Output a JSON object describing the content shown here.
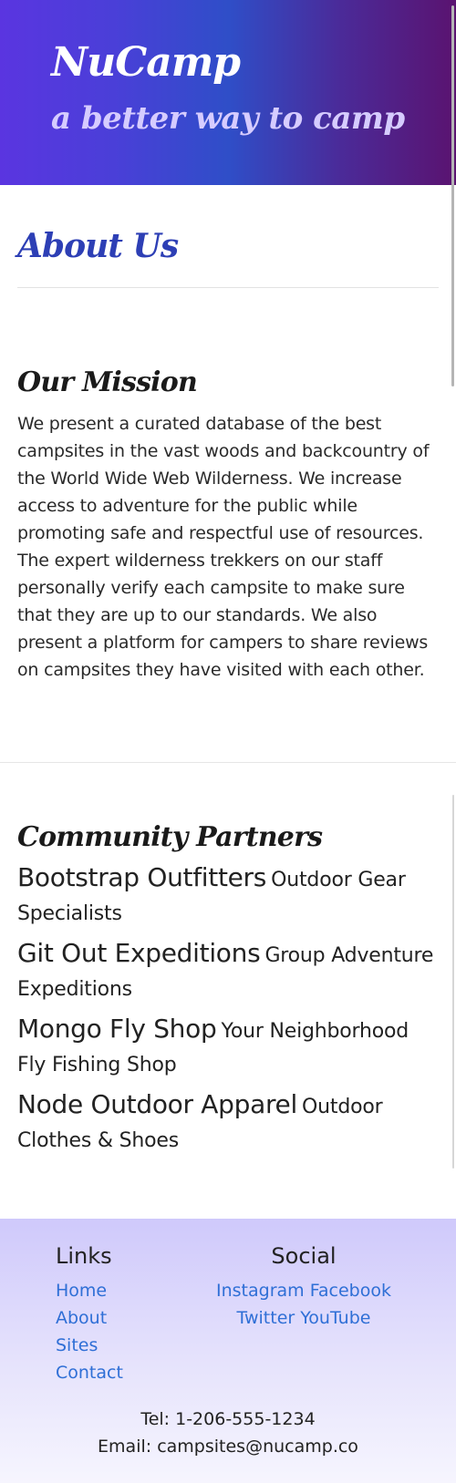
{
  "header": {
    "brand": "NuCamp",
    "tagline": "a better way to camp"
  },
  "page": {
    "title": "About Us"
  },
  "mission": {
    "title": "Our Mission",
    "text": "We present a curated database of the best campsites in the vast woods and backcountry of the World Wide Web Wilderness. We increase access to adventure for the public while promoting safe and respectful use of resources. The expert wilderness trekkers on our staff personally verify each campsite to make sure that they are up to our standards. We also present a platform for campers to share reviews on campsites they have visited with each other."
  },
  "partners": {
    "title": "Community Partners",
    "items": [
      {
        "name": "Bootstrap Outfitters",
        "desc": "Outdoor Gear Specialists"
      },
      {
        "name": "Git Out Expeditions",
        "desc": "Group Adventure Expeditions"
      },
      {
        "name": "Mongo Fly Shop",
        "desc": "Your Neighborhood Fly Fishing Shop"
      },
      {
        "name": "Node Outdoor Apparel",
        "desc": "Outdoor Clothes & Shoes"
      }
    ]
  },
  "footer": {
    "links_title": "Links",
    "links": [
      "Home",
      "About",
      "Sites",
      "Contact"
    ],
    "social_title": "Social",
    "social": [
      "Instagram",
      "Facebook",
      "Twitter",
      "YouTube"
    ],
    "tel": "Tel: 1-206-555-1234",
    "email": "Email: campsites@nucamp.co"
  }
}
